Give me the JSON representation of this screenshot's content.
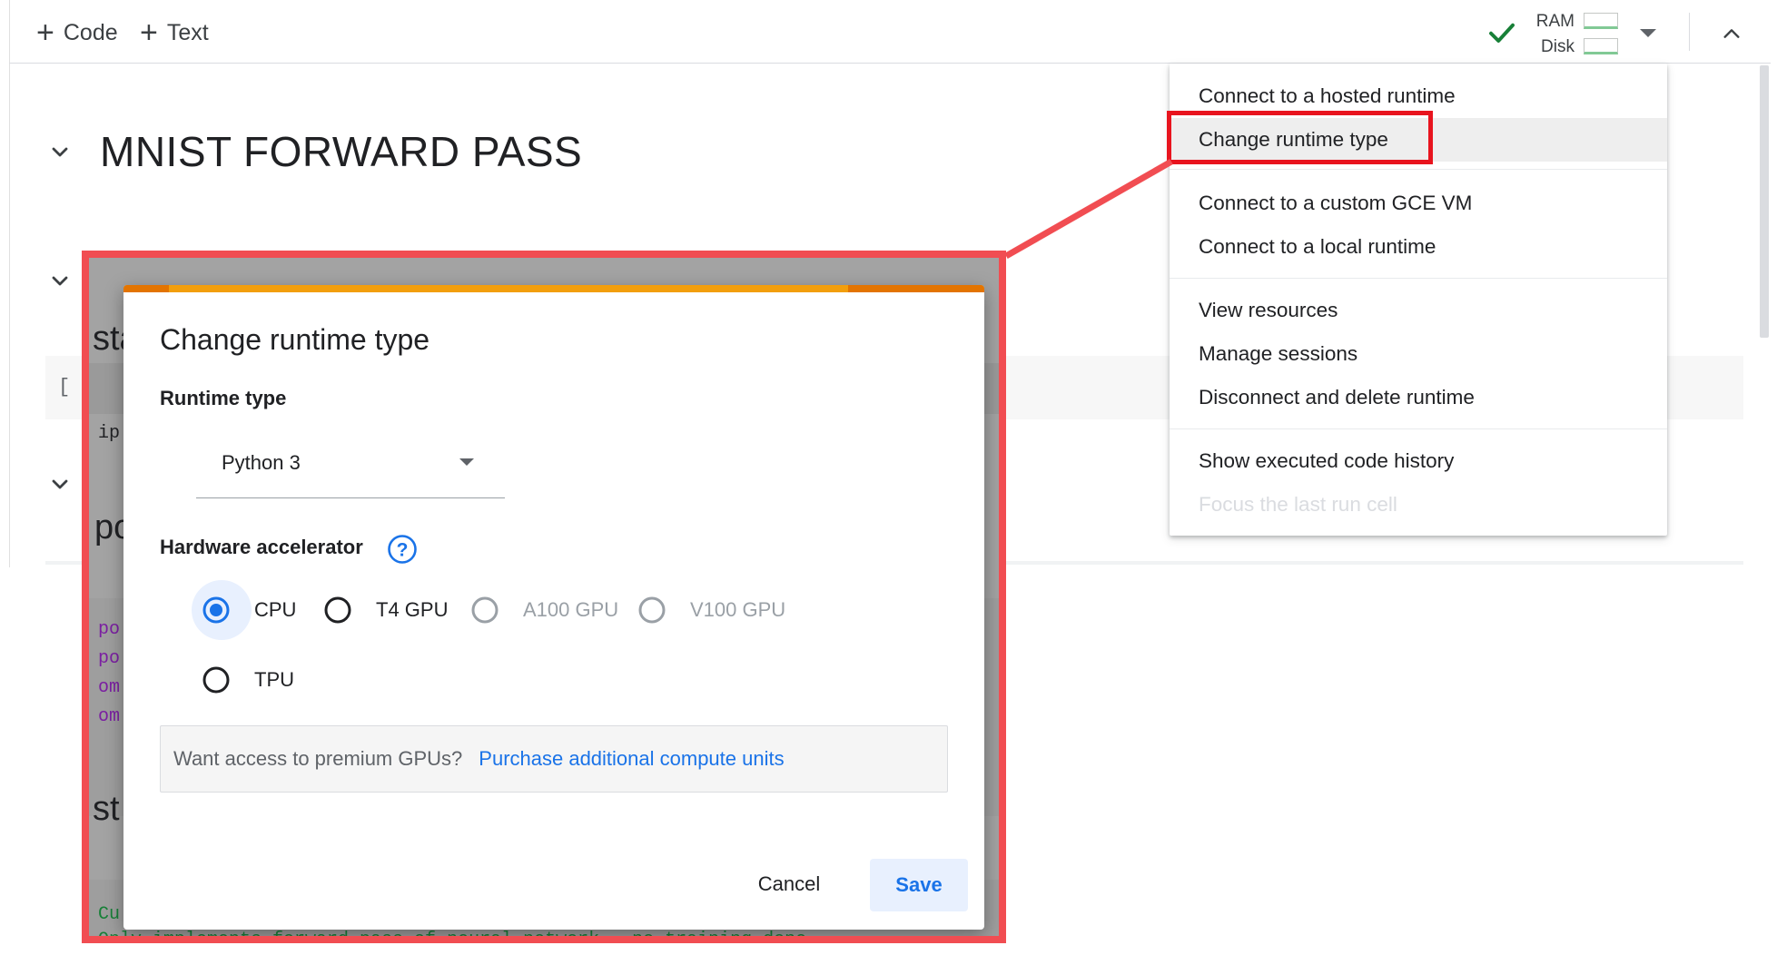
{
  "toolbar": {
    "code_label": "Code",
    "text_label": "Text",
    "ram_label": "RAM",
    "disk_label": "Disk"
  },
  "notebook": {
    "title": "MNIST FORWARD PASS",
    "cell_bracket": "[",
    "peek": {
      "sec2_text": "sta",
      "ip_text": "ip",
      "sec3_text": "po",
      "code_lines": [
        "po",
        "po",
        "om",
        "om"
      ],
      "sec4_text": "st",
      "comment_line1": "Cu",
      "comment_line2": "Only implements forward pass of neural network - no training done"
    }
  },
  "runtime_menu": {
    "items": [
      {
        "label": "Connect to a hosted runtime"
      },
      {
        "label": "Change runtime type"
      },
      {
        "label": "Connect to a custom GCE VM"
      },
      {
        "label": "Connect to a local runtime"
      },
      {
        "label": "View resources"
      },
      {
        "label": "Manage sessions"
      },
      {
        "label": "Disconnect and delete runtime"
      },
      {
        "label": "Show executed code history"
      },
      {
        "label": "Focus the last run cell"
      }
    ]
  },
  "dialog": {
    "title": "Change runtime type",
    "runtime_label": "Runtime type",
    "runtime_value": "Python 3",
    "hw_label": "Hardware accelerator",
    "options": [
      {
        "label": "CPU",
        "selected": true,
        "enabled": true
      },
      {
        "label": "T4 GPU",
        "selected": false,
        "enabled": true
      },
      {
        "label": "A100 GPU",
        "selected": false,
        "enabled": false
      },
      {
        "label": "V100 GPU",
        "selected": false,
        "enabled": false
      },
      {
        "label": "TPU",
        "selected": false,
        "enabled": true
      }
    ],
    "promo_text": "Want access to premium GPUs?",
    "promo_link": "Purchase additional compute units",
    "cancel_label": "Cancel",
    "save_label": "Save"
  },
  "colors": {
    "accent_blue": "#1a73e8",
    "highlight_red": "#e8141e",
    "callout_red": "#f14d52",
    "dialog_top_orange": "#f29e0c",
    "check_green": "#188038"
  },
  "icons": {
    "check": "check-icon",
    "help": "help-circle-icon",
    "chevron_down": "chevron-down-icon",
    "chevron_up": "chevron-up-icon",
    "plus": "plus-icon"
  }
}
